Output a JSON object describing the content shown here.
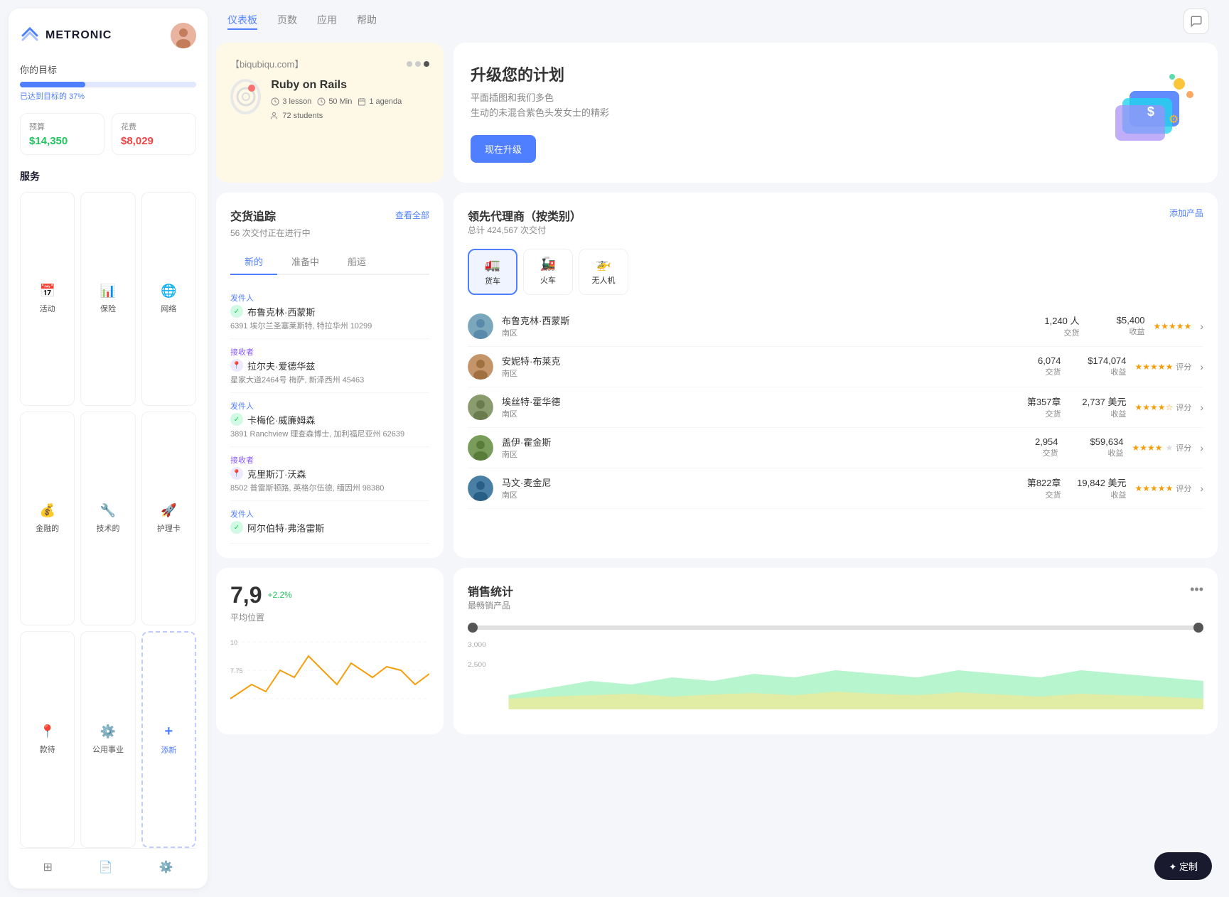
{
  "sidebar": {
    "logo_text": "METRONIC",
    "goal_label": "你的目标",
    "goal_percent": 37,
    "goal_percent_text": "已达到目标的 37%",
    "budget_label": "预算",
    "budget_value": "$14,350",
    "expense_label": "花费",
    "expense_value": "$8,029",
    "services_label": "服务",
    "services": [
      {
        "name": "活动",
        "icon": "📅"
      },
      {
        "name": "保险",
        "icon": "📊"
      },
      {
        "name": "网络",
        "icon": "🌐"
      },
      {
        "name": "金融的",
        "icon": "💰"
      },
      {
        "name": "技术的",
        "icon": "🔧"
      },
      {
        "name": "护理卡",
        "icon": "🚀"
      },
      {
        "name": "款待",
        "icon": "📍"
      },
      {
        "name": "公用事业",
        "icon": "⚙️"
      },
      {
        "name": "添新",
        "icon": "+",
        "type": "add"
      }
    ],
    "footer_icons": [
      "layers",
      "file",
      "settings"
    ]
  },
  "topnav": {
    "links": [
      {
        "label": "仪表板",
        "active": true
      },
      {
        "label": "页数",
        "active": false
      },
      {
        "label": "应用",
        "active": false
      },
      {
        "label": "帮助",
        "active": false
      }
    ]
  },
  "course_card": {
    "url": "【biqubiqu.com】",
    "title": "Ruby on Rails",
    "lessons": "3 lesson",
    "duration": "50 Min",
    "agenda": "1 agenda",
    "students": "72 students"
  },
  "upgrade_card": {
    "title": "升级您的计划",
    "desc_line1": "平面插图和我们多色",
    "desc_line2": "生动的未混合紫色头发女士的精彩",
    "button_label": "现在升级"
  },
  "tracking": {
    "title": "交货追踪",
    "subtitle": "56 次交付正在进行中",
    "view_all": "查看全部",
    "tabs": [
      "新的",
      "准备中",
      "船运"
    ],
    "active_tab": 0,
    "items": [
      {
        "role": "发件人",
        "name": "布鲁克林·西蒙斯",
        "address": "6391 埃尔兰圣塞莱斯特, 特拉华州 10299",
        "icon_type": "green"
      },
      {
        "role": "接收者",
        "name": "拉尔夫·爱德华兹",
        "address": "星家大道2464号 梅萨, 新泽西州 45463",
        "icon_type": "purple"
      },
      {
        "role": "发件人",
        "name": "卡梅伦·威廉姆森",
        "address": "3891 Ranchview 理查森博士, 加利福尼亚州 62639",
        "icon_type": "green"
      },
      {
        "role": "接收者",
        "name": "克里斯汀·沃森",
        "address": "8502 普雷斯顿路, 英格尔伍德, 缅因州 98380",
        "icon_type": "purple"
      },
      {
        "role": "发件人",
        "name": "阿尔伯特·弗洛雷斯",
        "address": "",
        "icon_type": "green"
      }
    ]
  },
  "agents": {
    "title": "领先代理商（按类别）",
    "subtitle": "总计 424,567 次交付",
    "add_product": "添加产品",
    "tabs": [
      {
        "label": "货车",
        "icon": "🚛",
        "active": true
      },
      {
        "label": "火车",
        "icon": "🚂",
        "active": false
      },
      {
        "label": "无人机",
        "icon": "🚁",
        "active": false
      }
    ],
    "rows": [
      {
        "name": "布鲁克林·西蒙斯",
        "region": "南区",
        "transactions": "1,240 人",
        "trans_label": "交货",
        "revenue": "$5,400",
        "rev_label": "收益",
        "rating": 5,
        "rating_label": "",
        "color": "#7ba7bc"
      },
      {
        "name": "安妮特·布莱克",
        "region": "南区",
        "transactions": "6,074",
        "trans_label": "交货",
        "revenue": "$174,074",
        "rev_label": "收益",
        "rating": 4.5,
        "rating_label": "评分",
        "color": "#c4956a"
      },
      {
        "name": "埃丝特·霍华德",
        "region": "南区",
        "transactions": "第357章",
        "trans_label": "交货",
        "revenue": "2,737 美元",
        "rev_label": "收益",
        "rating": 4,
        "rating_label": "评分",
        "color": "#8a9b6e"
      },
      {
        "name": "盖伊·霍金斯",
        "region": "南区",
        "transactions": "2,954",
        "trans_label": "交货",
        "revenue": "$59,634",
        "rev_label": "收益",
        "rating": 3.5,
        "rating_label": "评分",
        "color": "#7a9c5b"
      },
      {
        "name": "马文·麦金尼",
        "region": "南区",
        "transactions": "第822章",
        "trans_label": "交货",
        "revenue": "19,842 美元",
        "rev_label": "收益",
        "rating": 5,
        "rating_label": "评分",
        "color": "#4a7fa5"
      }
    ]
  },
  "position_score": {
    "value": "7,9",
    "change": "+2.2%",
    "label": "平均位置",
    "y_max": 10,
    "y_mid": 7.75
  },
  "sales": {
    "title": "销售统计",
    "subtitle": "最畅销产品"
  },
  "customize_btn": "✦ 定制"
}
